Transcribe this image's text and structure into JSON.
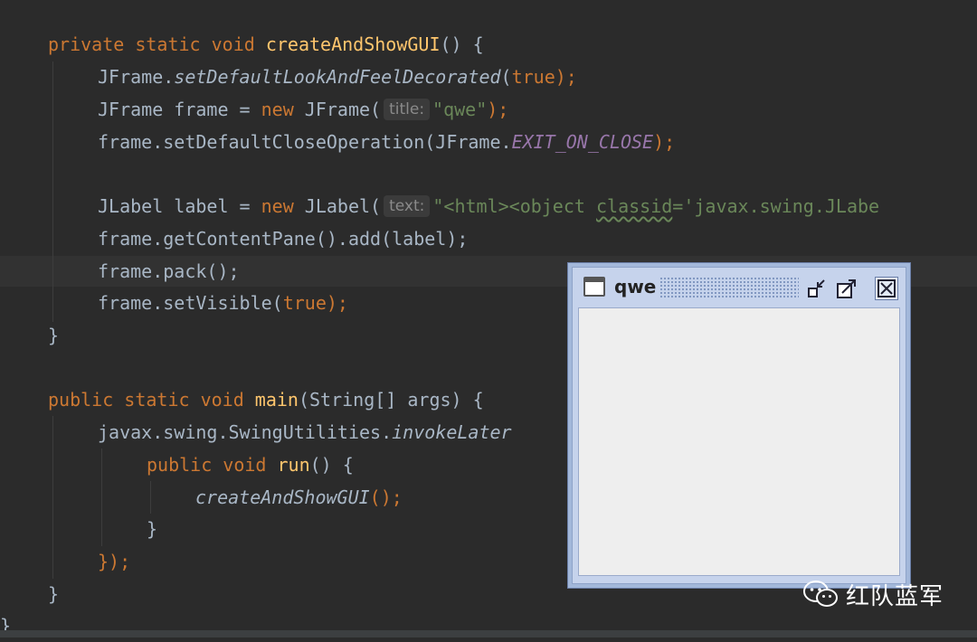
{
  "editor": {
    "lines": {
      "l1": {
        "mods": "private static void ",
        "name": "createAndShowGUI",
        "rest": "() {"
      },
      "l2": {
        "recv": "JFrame.",
        "call": "setDefaultLookAndFeelDecorated",
        "open": "(",
        "arg": "true",
        "close": ");"
      },
      "l3": {
        "pre": "JFrame frame = ",
        "kw": "new",
        "post": " JFrame(",
        "hint": "title:",
        "str": "\"qwe\"",
        "close": ");"
      },
      "l4": {
        "pre": "frame.setDefaultCloseOperation(JFrame.",
        "const": "EXIT_ON_CLOSE",
        "close": ");"
      },
      "l5": {
        "pre": "JLabel label = ",
        "kw": "new",
        "post": " JLabel(",
        "hint": "text:",
        "str1": "\"<html><object ",
        "warn": "classid",
        "str2": "='javax.swing.JLabe"
      },
      "l6": {
        "text": "frame.getContentPane().add(label);"
      },
      "l7": {
        "text": "frame.pack();"
      },
      "l8": {
        "pre": "frame.setVisible(",
        "arg": "true",
        "close": ");"
      },
      "l9": {
        "text": "}"
      },
      "l10": {
        "mods": "public static void ",
        "name": "main",
        "rest": "(String[] args) {"
      },
      "l11": {
        "pre": "javax.swing.SwingUtilities.",
        "call": "invokeLater"
      },
      "l12": {
        "mods": "public void ",
        "name": "run",
        "rest": "() {"
      },
      "l13": {
        "call": "createAndShowGUI",
        "rest": "();"
      },
      "l14": {
        "text": "}"
      },
      "l15": {
        "text": "});"
      },
      "l16": {
        "text": "}"
      },
      "l17": {
        "text": "}"
      }
    }
  },
  "window": {
    "title": "qwe",
    "icons": {
      "app": "window-icon",
      "iconify": "minimize-icon",
      "maximize": "maximize-icon",
      "close": "close-icon"
    }
  },
  "watermark": {
    "text": "红队蓝军",
    "icon": "wechat-icon"
  },
  "colors": {
    "editor_bg": "#2b2b2b",
    "keyword": "#cc7832",
    "function": "#ffc66d",
    "string": "#6a8759",
    "constant": "#9876aa",
    "text": "#a9b7c6",
    "window_frame": "#a3b8da"
  }
}
